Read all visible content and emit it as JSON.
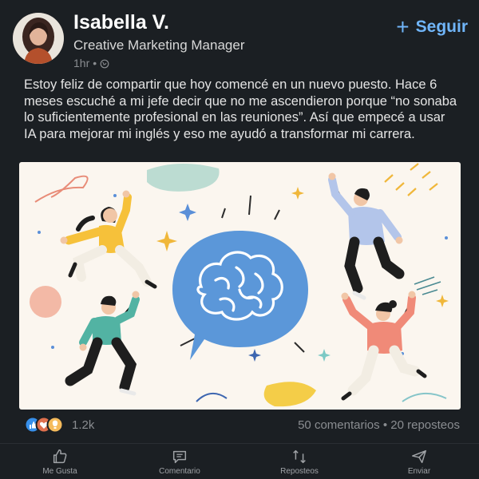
{
  "author": {
    "name": "Isabella V.",
    "headline": "Creative Marketing Manager",
    "time": "1hr",
    "separator": "•"
  },
  "follow": {
    "label": "Seguir"
  },
  "post": {
    "text": "Estoy feliz de compartir que hoy comencé en un nuevo puesto. Hace 6 meses escuché a mi jefe decir que no me ascendieron porque “no sonaba lo suficientemente profesional en las reuniones”. Así que empecé a usar IA para mejorar mi inglés y eso me ayudó a transformar mi carrera."
  },
  "social": {
    "reactions": "1.2k",
    "comments": "50 comentarios",
    "dot": "•",
    "reposts": "20 reposteos"
  },
  "actions": [
    {
      "label": "Me Gusta",
      "icon": "thumbs-up-icon"
    },
    {
      "label": "Comentario",
      "icon": "comment-icon"
    },
    {
      "label": "Reposteos",
      "icon": "repost-icon"
    },
    {
      "label": "Enviar",
      "icon": "send-icon"
    }
  ],
  "colors": {
    "background": "#1b1f23",
    "accent": "#70b5f9",
    "brain_bubble": "#5b97d9"
  }
}
